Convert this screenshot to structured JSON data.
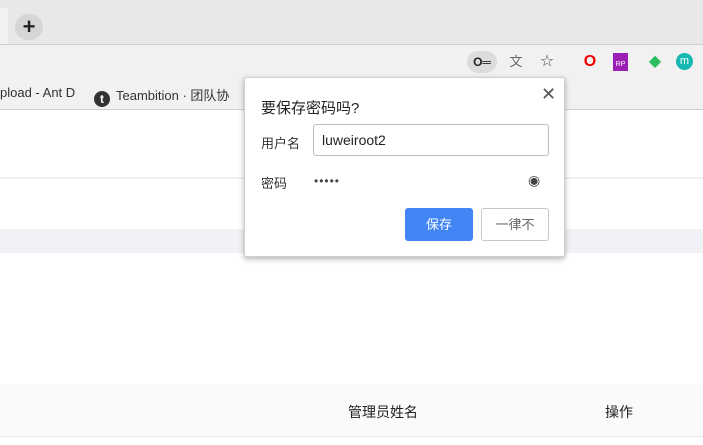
{
  "browser": {
    "new_tab_label": "+",
    "toolbar_icons": [
      "key-icon",
      "translate-icon",
      "star-icon",
      "opera-icon",
      "rp-icon",
      "evernote-icon",
      "m-extension-icon"
    ],
    "extension_m_label": "m",
    "bookmarks": [
      {
        "label": "pload - Ant D"
      },
      {
        "label": "Teambition · 团队协",
        "icon_letter": "t"
      }
    ]
  },
  "dialog": {
    "title": "要保存密码吗?",
    "username_label": "用户名",
    "username_value": "luweiroot2",
    "password_label": "密码",
    "password_value": "•••••",
    "save_label": "保存",
    "never_label": "一律不"
  },
  "table": {
    "headers": [
      "管理员姓名",
      "操作"
    ]
  },
  "colors": {
    "accent": "#4285f4"
  }
}
